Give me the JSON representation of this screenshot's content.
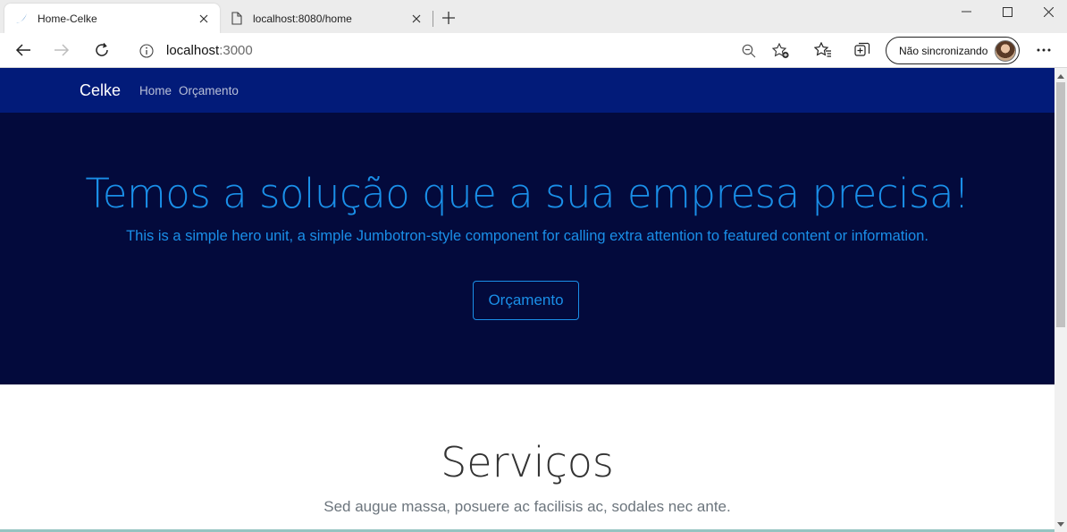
{
  "browser": {
    "tabs": [
      {
        "title": "Home-Celke",
        "active": true,
        "icon": "celke-favicon-icon"
      },
      {
        "title": "localhost:8080/home",
        "active": false,
        "icon": "page-icon"
      }
    ],
    "address": {
      "host": "localhost",
      "port": ":3000"
    },
    "profile_label": "Não sincronizando"
  },
  "navbar": {
    "brand": "Celke",
    "links": [
      "Home",
      "Orçamento"
    ],
    "background": "#021b79"
  },
  "hero": {
    "title": "Temos a solução que a sua empresa precisa!",
    "lead": "This is a simple hero unit, a simple Jumbotron-style component for calling extra attention to featured content or information.",
    "button": "Orçamento",
    "background": "#030a3c",
    "accent": "#1a8fe8"
  },
  "services": {
    "title": "Serviços",
    "lead": "Sed augue massa, posuere ac facilisis ac, sodales nec ante."
  }
}
